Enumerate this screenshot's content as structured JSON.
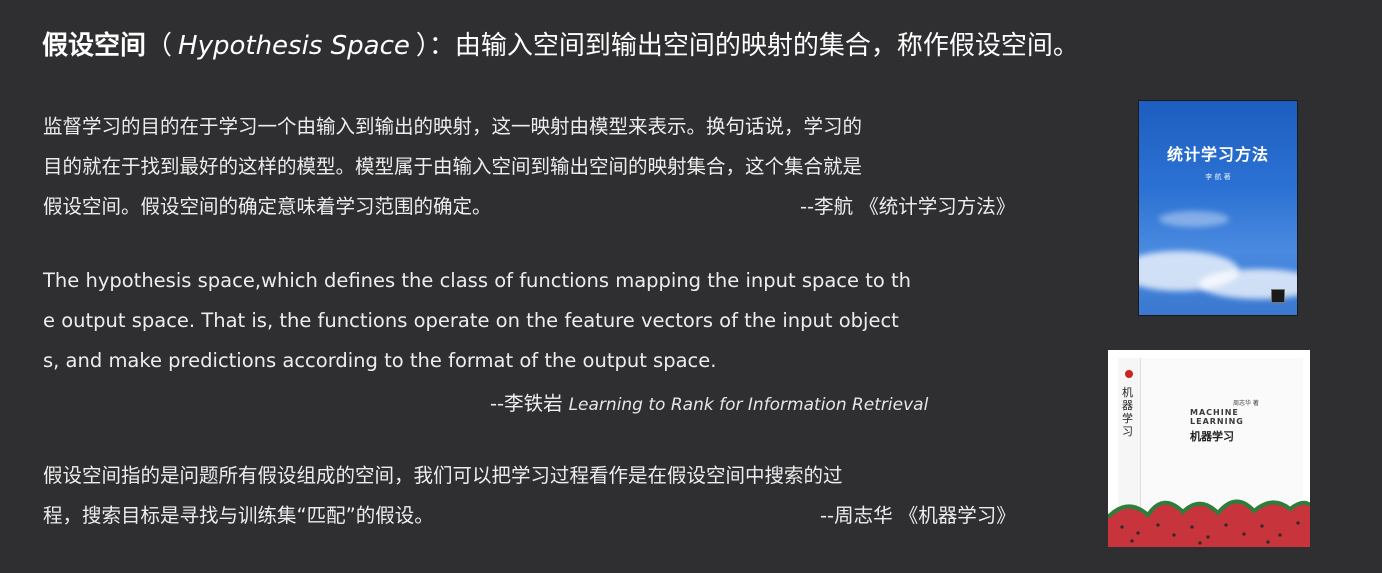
{
  "title": {
    "bold": "假设空间",
    "open_paren": "（",
    "en": "Hypothesis Space",
    "close_paren": "）",
    "rest": "：由输入空间到输出空间的映射的集合，称作假设空间。"
  },
  "para1": {
    "line1": "监督学习的目的在于学习一个由输入到输出的映射，这一映射由模型来表示。换句话说，学习的",
    "line2": "目的就在于找到最好的这样的模型。模型属于由输入空间到输出空间的映射集合，这个集合就是",
    "line3": "假设空间。假设空间的确定意味着学习范围的确定。",
    "citation": "--李航 《统计学习方法》"
  },
  "para2": {
    "line1": "The hypothesis space,which defines the class of functions mapping the input space to th",
    "line2": "e output space. That is, the functions operate on the feature vectors of the input object",
    "line3": "s, and make predictions according to the format of the output space.",
    "citation_author": "--李铁岩",
    "citation_book": "Learning to Rank for Information Retrieval"
  },
  "para3": {
    "line1": "假设空间指的是问题所有假设组成的空间，我们可以把学习过程看作是在假设空间中搜索的过",
    "line2": "程，搜索目标是寻找与训练集“匹配”的假设。",
    "citation": "--周志华 《机器学习》"
  },
  "book1": {
    "title": "统计学习方法",
    "author": "李 航 著"
  },
  "book2": {
    "spine": "机器学习",
    "author": "周志华 著",
    "en_line1": "MACHINE",
    "en_line2": "LEARNING",
    "zh_title": "机器学习"
  }
}
